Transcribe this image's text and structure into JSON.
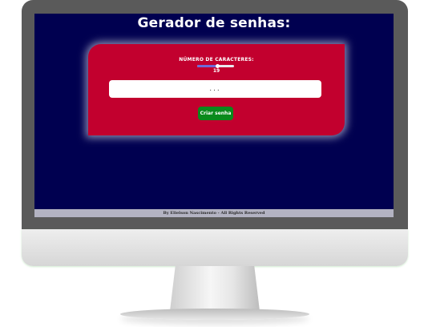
{
  "app": {
    "title": "Gerador de senhas:"
  },
  "generator": {
    "length_label": "NÚMERO DE CARACTERES:",
    "length_value": "19",
    "length_fraction": 0.55,
    "password_placeholder": "...",
    "button_label": "Criar senha"
  },
  "footer": {
    "text": "By Elielson Nascimento - All Rights Reserved"
  },
  "colors": {
    "background": "#000050",
    "card": "#c2002e",
    "button": "#0a8a1c",
    "slider_fill": "#6f6ad8"
  }
}
